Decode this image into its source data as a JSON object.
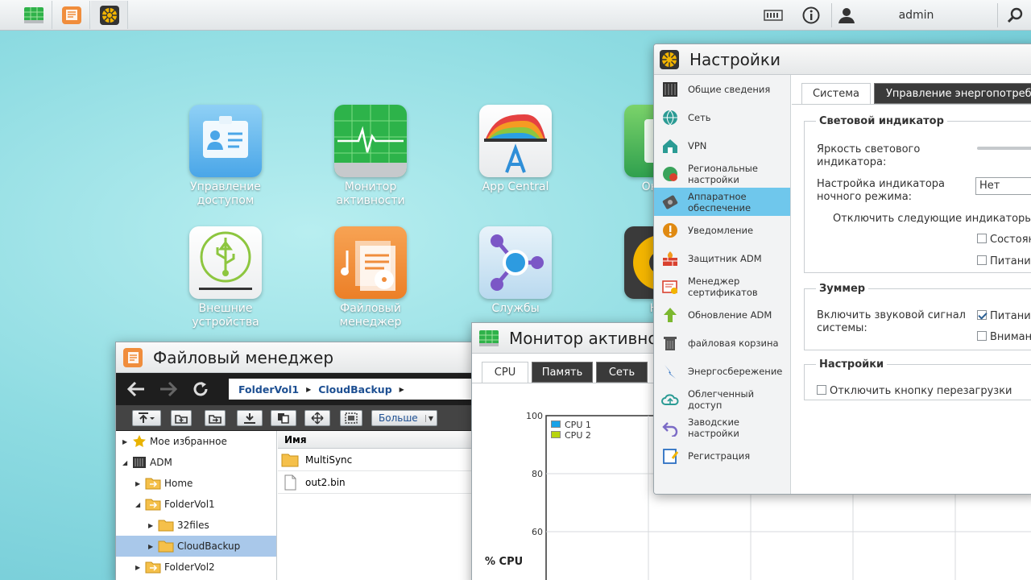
{
  "topbar": {
    "apps": [
      "activity-monitor-icon",
      "file-manager-icon",
      "settings-icon"
    ],
    "user": "admin"
  },
  "desktop": {
    "icons": [
      {
        "label": "Управление доступом",
        "icon": "access-control-icon"
      },
      {
        "label": "Монитор активности",
        "icon": "activity-monitor-icon"
      },
      {
        "label": "App Central",
        "icon": "app-central-icon"
      },
      {
        "label": "Онлай",
        "icon": "online-icon"
      },
      {
        "label": "Внешние устройства",
        "icon": "usb-icon"
      },
      {
        "label": "Файловый менеджер",
        "icon": "file-manager-icon"
      },
      {
        "label": "Службы",
        "icon": "services-icon"
      },
      {
        "label": "Нас",
        "icon": "settings-gear-icon"
      }
    ]
  },
  "settings": {
    "title": "Настройки",
    "sidebar": [
      {
        "label": "Общие сведения",
        "icon": "server-icon"
      },
      {
        "label": "Сеть",
        "icon": "globe-icon"
      },
      {
        "label": "VPN",
        "icon": "vpn-house-icon"
      },
      {
        "label": "Региональные настройки",
        "icon": "regional-globe-icon"
      },
      {
        "label": "Аппаратное обеспечение",
        "icon": "hardware-icon"
      },
      {
        "label": "Уведомление",
        "icon": "alert-icon"
      },
      {
        "label": "Защитник ADM",
        "icon": "firewall-icon"
      },
      {
        "label": "Менеджер сертификатов",
        "icon": "certificate-icon"
      },
      {
        "label": "Обновление ADM",
        "icon": "update-arrow-icon"
      },
      {
        "label": "файловая корзина",
        "icon": "trash-icon"
      },
      {
        "label": "Энергосбережение",
        "icon": "power-save-icon"
      },
      {
        "label": "Облегченный доступ",
        "icon": "cloud-icon"
      },
      {
        "label": "Заводские настройки",
        "icon": "reset-icon"
      },
      {
        "label": "Регистрация",
        "icon": "registration-icon"
      }
    ],
    "tabs": [
      "Система",
      "Управление энергопотребл"
    ],
    "led_section": {
      "legend": "Световой индикатор",
      "brightness_label": "Яркость светового индикатора:",
      "night_label": "Настройка индикатора ночного режима:",
      "night_value": "Нет",
      "disable_text": "Отключить следующие индикаторы в",
      "options": [
        "Состоян",
        "Питание"
      ]
    },
    "buzzer_section": {
      "legend": "Зуммер",
      "label": "Включить звуковой сигнал системы:",
      "options": [
        "Питание",
        "Внимани"
      ]
    },
    "settings_section": {
      "legend": "Настройки",
      "reboot_label": "Отключить кнопку перезагрузки"
    }
  },
  "monitor": {
    "title": "Монитор активнос",
    "tabs": [
      "CPU",
      "Память",
      "Сеть"
    ],
    "ylabel": "% CPU",
    "legend": [
      "CPU 1",
      "CPU 2"
    ],
    "colors": {
      "cpu1": "#1aa3e8",
      "cpu2": "#b7d40f"
    }
  },
  "chart_data": {
    "type": "line",
    "ylabel": "% CPU",
    "yticks": [
      100,
      80,
      60
    ],
    "series": [
      {
        "name": "CPU 1",
        "values": []
      },
      {
        "name": "CPU 2",
        "values": []
      }
    ]
  },
  "filemanager": {
    "title": "Файловый менеджер",
    "path": [
      "FolderVol1",
      "CloudBackup"
    ],
    "more_label": "Больше",
    "tree": [
      {
        "label": "Мое избранное",
        "level": 0
      },
      {
        "label": "ADM",
        "level": 0
      },
      {
        "label": "Home",
        "level": 1
      },
      {
        "label": "FolderVol1",
        "level": 1
      },
      {
        "label": "32files",
        "level": 2
      },
      {
        "label": "CloudBackup",
        "level": 2
      },
      {
        "label": "FolderVol2",
        "level": 1
      }
    ],
    "column_name": "Имя",
    "files": [
      {
        "name": "MultiSync",
        "type": "folder"
      },
      {
        "name": "out2.bin",
        "type": "file"
      }
    ]
  }
}
